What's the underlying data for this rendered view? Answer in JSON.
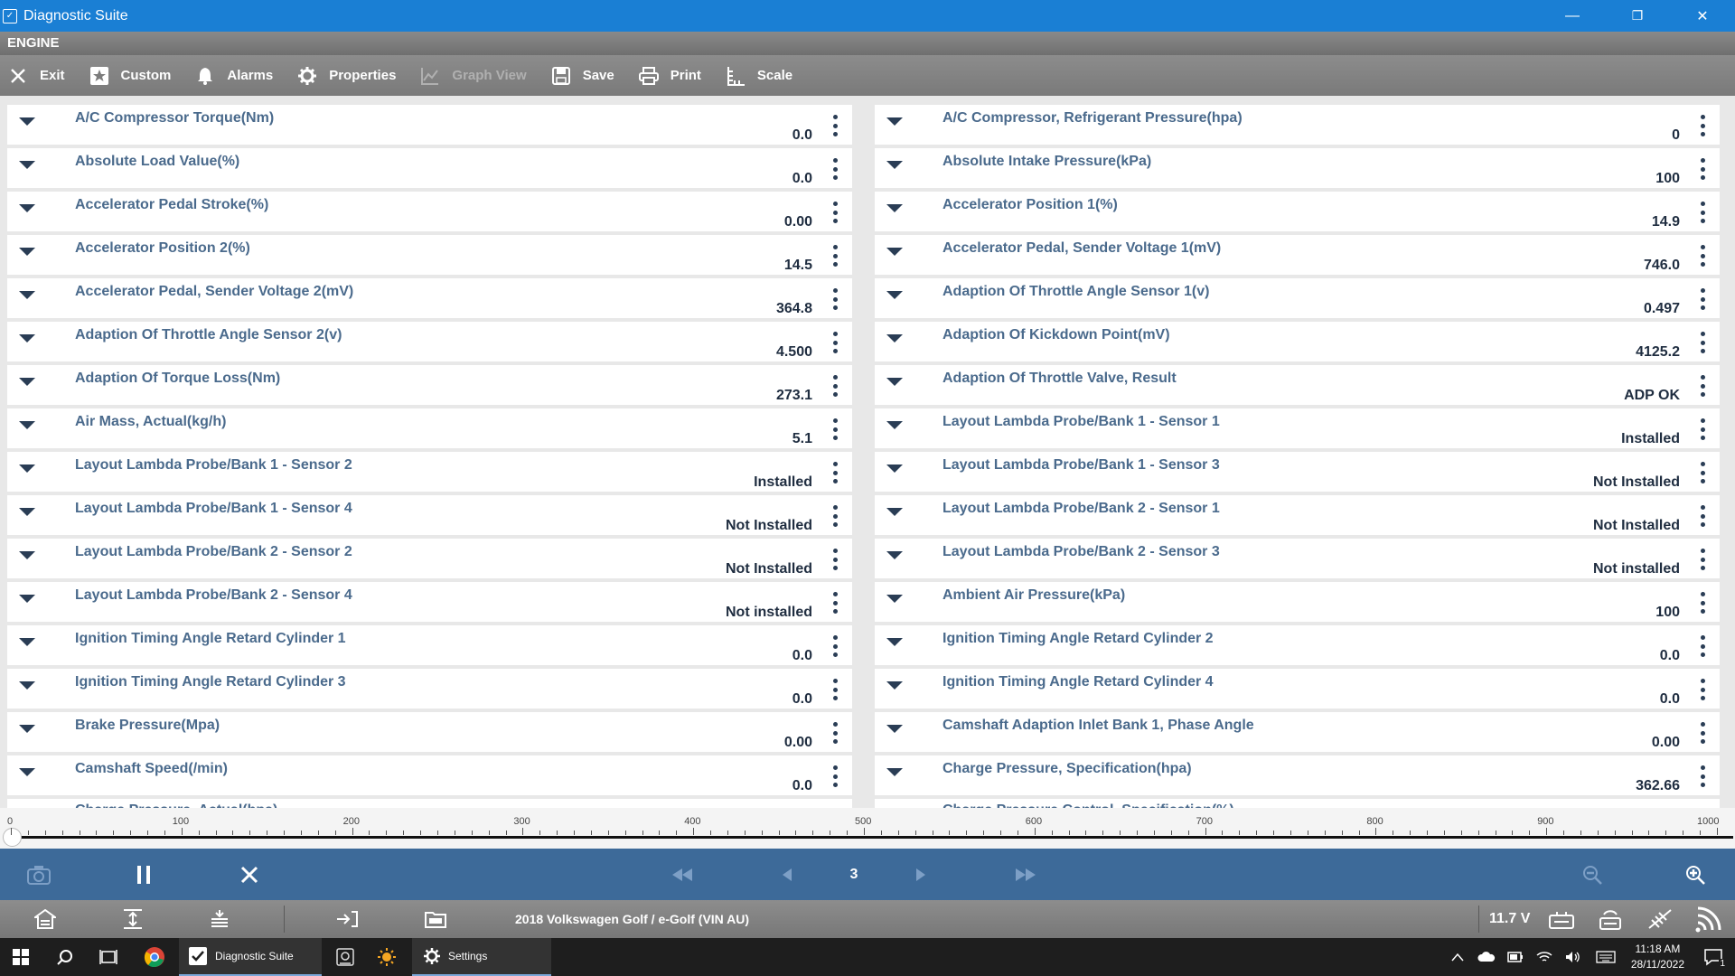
{
  "window": {
    "title": "Diagnostic Suite",
    "minimize": "—",
    "maximize": "❐",
    "close": "✕"
  },
  "section": {
    "title": "ENGINE"
  },
  "toolbar": {
    "exit": "Exit",
    "custom": "Custom",
    "alarms": "Alarms",
    "properties": "Properties",
    "graph_view": "Graph View",
    "save": "Save",
    "print": "Print",
    "scale": "Scale"
  },
  "params_left": [
    {
      "name": "A/C Compressor Torque(Nm)",
      "value": "0.0"
    },
    {
      "name": "Absolute Load Value(%)",
      "value": "0.0"
    },
    {
      "name": "Accelerator Pedal Stroke(%)",
      "value": "0.00"
    },
    {
      "name": "Accelerator Position 2(%)",
      "value": "14.5"
    },
    {
      "name": "Accelerator Pedal, Sender Voltage 2(mV)",
      "value": "364.8"
    },
    {
      "name": "Adaption Of Throttle Angle Sensor 2(v)",
      "value": "4.500"
    },
    {
      "name": "Adaption Of Torque Loss(Nm)",
      "value": "273.1"
    },
    {
      "name": "Air Mass, Actual(kg/h)",
      "value": "5.1"
    },
    {
      "name": "Layout Lambda Probe/Bank 1 - Sensor 2",
      "value": "Installed"
    },
    {
      "name": "Layout Lambda Probe/Bank 1 - Sensor 4",
      "value": "Not Installed"
    },
    {
      "name": "Layout Lambda Probe/Bank 2 - Sensor 2",
      "value": "Not Installed"
    },
    {
      "name": "Layout Lambda Probe/Bank 2 - Sensor 4",
      "value": "Not installed"
    },
    {
      "name": "Ignition Timing Angle Retard Cylinder 1",
      "value": "0.0"
    },
    {
      "name": "Ignition Timing Angle Retard Cylinder 3",
      "value": "0.0"
    },
    {
      "name": "Brake Pressure(Mpa)",
      "value": "0.00"
    },
    {
      "name": "Camshaft Speed(/min)",
      "value": "0.0"
    }
  ],
  "params_left_partial": "Charge Pressure, Actual(hpa)",
  "params_right": [
    {
      "name": "A/C Compressor, Refrigerant Pressure(hpa)",
      "value": "0"
    },
    {
      "name": "Absolute Intake Pressure(kPa)",
      "value": "100"
    },
    {
      "name": "Accelerator Position 1(%)",
      "value": "14.9"
    },
    {
      "name": "Accelerator Pedal, Sender Voltage 1(mV)",
      "value": "746.0"
    },
    {
      "name": "Adaption Of Throttle Angle Sensor 1(v)",
      "value": "0.497"
    },
    {
      "name": "Adaption Of Kickdown Point(mV)",
      "value": "4125.2"
    },
    {
      "name": "Adaption Of Throttle Valve, Result",
      "value": "ADP OK"
    },
    {
      "name": "Layout Lambda Probe/Bank 1 - Sensor 1",
      "value": "Installed"
    },
    {
      "name": "Layout Lambda Probe/Bank 1 - Sensor 3",
      "value": "Not Installed"
    },
    {
      "name": "Layout Lambda Probe/Bank 2 - Sensor 1",
      "value": "Not Installed"
    },
    {
      "name": "Layout Lambda Probe/Bank 2 - Sensor 3",
      "value": "Not installed"
    },
    {
      "name": "Ambient Air Pressure(kPa)",
      "value": "100"
    },
    {
      "name": "Ignition Timing Angle Retard Cylinder 2",
      "value": "0.0"
    },
    {
      "name": "Ignition Timing Angle Retard Cylinder 4",
      "value": "0.0"
    },
    {
      "name": "Camshaft Adaption Inlet Bank 1, Phase Angle",
      "value": "0.00"
    },
    {
      "name": "Charge Pressure, Specification(hpa)",
      "value": "362.66"
    }
  ],
  "params_right_partial": "Charge Pressure Control, Specification(%)",
  "ruler": {
    "ticks": [
      "0",
      "100",
      "200",
      "300",
      "400",
      "500",
      "600",
      "700",
      "800",
      "900",
      "1000"
    ],
    "position": 0
  },
  "playback": {
    "page": "3"
  },
  "status": {
    "vehicle": "2018 Volkswagen Golf / e-Golf (VIN AU)",
    "voltage": "11.7 V"
  },
  "taskbar": {
    "diagnostic_suite": "Diagnostic Suite",
    "settings": "Settings",
    "time": "11:18 AM",
    "date": "28/11/2022",
    "notification_count": "1"
  }
}
